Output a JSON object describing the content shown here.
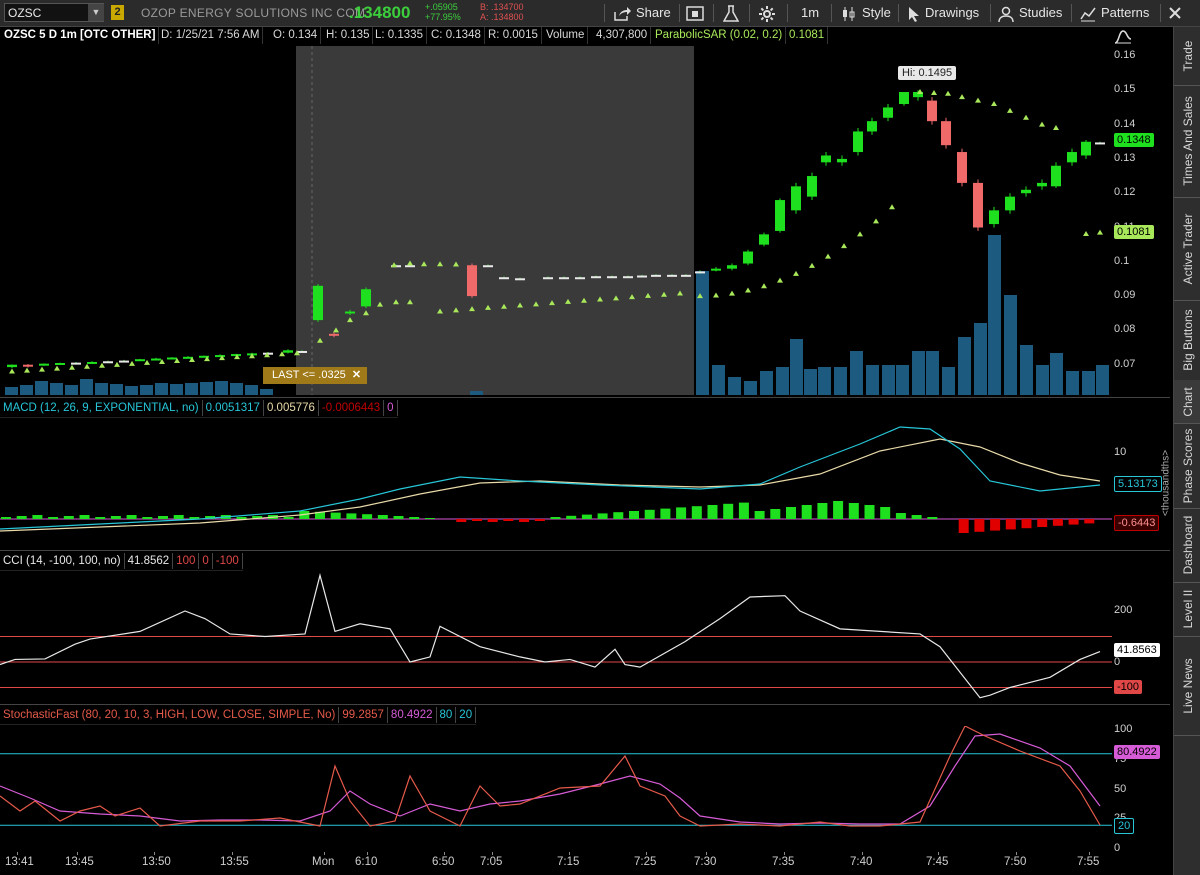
{
  "toolbar": {
    "symbol": "OZSC",
    "link_number": "2",
    "company": "OZOP ENERGY SOLUTIONS INC COM",
    "last": ".134800",
    "net_change": "+.05905",
    "percent_change": "+77.95%",
    "bid": "B: .134700",
    "ask": "A: .134800",
    "share": "Share",
    "aggregation": "1m",
    "style": "Style",
    "drawings": "Drawings",
    "studies": "Studies",
    "patterns": "Patterns"
  },
  "header": {
    "title": "OZSC 5 D 1m [OTC OTHER]",
    "date": "D: 1/25/21 7:56 AM",
    "open": "O: 0.134",
    "high": "H: 0.135",
    "low": "L: 0.1335",
    "close": "C: 0.1348",
    "range": "R: 0.0015",
    "volume_label": "Volume",
    "volume_value": "4,307,800",
    "sar_label": "ParabolicSAR (0.02, 0.2)",
    "sar_value": "0.1081"
  },
  "price_pane": {
    "hi_bubble": "Hi: 0.1495",
    "last_alert": "LAST <= .0325",
    "axis_labels": [
      "0.16",
      "0.15",
      "0.14",
      "0.13",
      "0.12",
      "0.11",
      "0.1",
      "0.09",
      "0.08",
      "0.07"
    ],
    "price_tag": "0.1348",
    "sar_tag": "0.1081"
  },
  "macd_pane": {
    "title": "MACD (12, 26, 9, EXPONENTIAL, no)",
    "value": "0.0051317",
    "avg": "0.005776",
    "diff": "-0.0006443",
    "zero": "0",
    "axis_label": "10",
    "units": "<thousandths>",
    "value_tag": "5.13173",
    "diff_tag": "-0.6443"
  },
  "cci_pane": {
    "title": "CCI (14, -100, 100, no)",
    "value": "41.8562",
    "ob": "100",
    "zero": "0",
    "os": "-100",
    "axis_labels": [
      "200",
      "0"
    ],
    "value_tag": "41.8563",
    "os_tag": "-100"
  },
  "stoch_pane": {
    "title": "StochasticFast (80, 20, 10, 3, HIGH, LOW, CLOSE, SIMPLE, No)",
    "k": "99.2857",
    "d": "80.4922",
    "ob": "80",
    "os": "20",
    "axis_labels": [
      "100",
      "75",
      "50",
      "25",
      "0"
    ],
    "d_tag": "80.4922",
    "os_tag": "20"
  },
  "x_axis": [
    "13:41",
    "13:45",
    "13:50",
    "13:55",
    "Mon",
    "6:10",
    "6:50",
    "7:05",
    "7:15",
    "7:25",
    "7:30",
    "7:35",
    "7:40",
    "7:45",
    "7:50",
    "7:55"
  ],
  "right_tabs": [
    "Trade",
    "Times And Sales",
    "Active Trader",
    "Big Buttons",
    "Chart",
    "Phase Scores",
    "Dashboard",
    "Level II",
    "Live News"
  ],
  "colors": {
    "up": "#1ee01e",
    "down": "#f06a6a",
    "sar": "#a8e85a",
    "volume": "#1c5a80",
    "macd": "#27c6d8",
    "macd_avg": "#e8d9a8",
    "hist_up": "#1ee01e",
    "hist_down": "#e00000",
    "cci_line": "#e8e8e8",
    "ref": "#e04848",
    "stoch_k": "#e55a4a",
    "stoch_d": "#d65bd6",
    "stoch_ref": "#27c6d8",
    "session_shade": "#3a3a3a"
  }
}
